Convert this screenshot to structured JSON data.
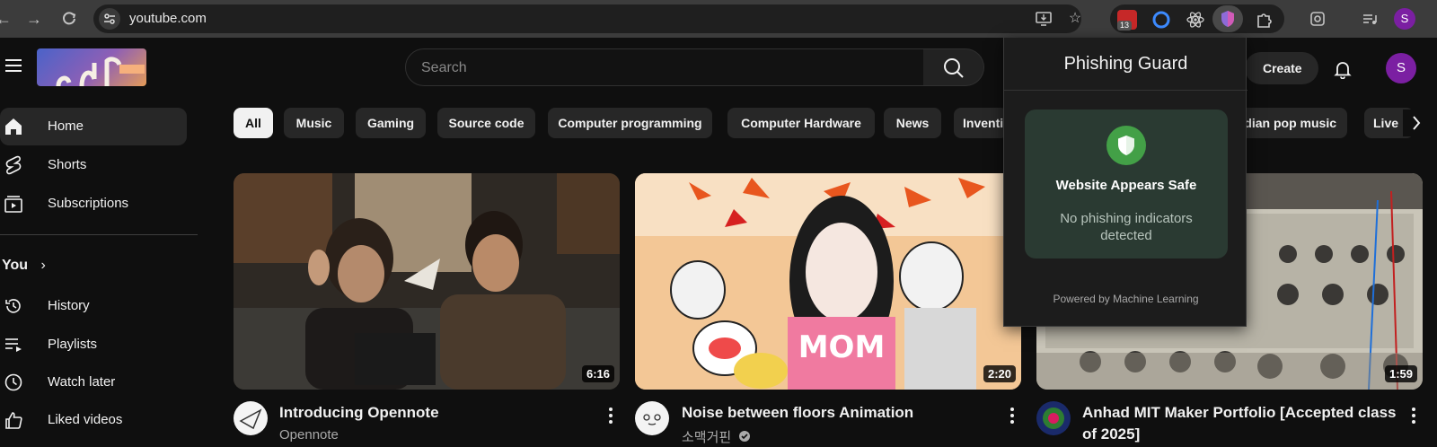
{
  "browser": {
    "url": "youtube.com",
    "badge_count": "13",
    "profile_initial": "S"
  },
  "header": {
    "search_placeholder": "Search",
    "create_label": "Create",
    "avatar_initial": "S"
  },
  "sidebar": {
    "items": [
      {
        "label": "Home",
        "icon": "home-icon"
      },
      {
        "label": "Shorts",
        "icon": "shorts-icon"
      },
      {
        "label": "Subscriptions",
        "icon": "subscriptions-icon"
      }
    ],
    "you_label": "You",
    "you_items": [
      {
        "label": "History",
        "icon": "history-icon"
      },
      {
        "label": "Playlists",
        "icon": "playlists-icon"
      },
      {
        "label": "Watch later",
        "icon": "clock-icon"
      },
      {
        "label": "Liked videos",
        "icon": "thumbs-up-icon"
      }
    ]
  },
  "chips": [
    "All",
    "Music",
    "Gaming",
    "Source code",
    "Computer programming",
    "Computer Hardware",
    "News",
    "Inventi",
    "ndian pop music",
    "Live"
  ],
  "videos": [
    {
      "title": "Introducing Opennote",
      "channel": "Opennote",
      "duration": "6:16"
    },
    {
      "title": "Noise between floors Animation",
      "channel": "소맥거핀",
      "duration": "2:20"
    },
    {
      "title_line1": "Anhad MIT Maker Portfolio [Accepted class",
      "title_line2": "of 2025]",
      "duration": "1:59"
    }
  ],
  "popup": {
    "title": "Phishing Guard",
    "status_title": "Website Appears Safe",
    "status_desc": "No phishing indicators detected",
    "footer": "Powered by Machine Learning",
    "safe_color": "#43a047"
  }
}
